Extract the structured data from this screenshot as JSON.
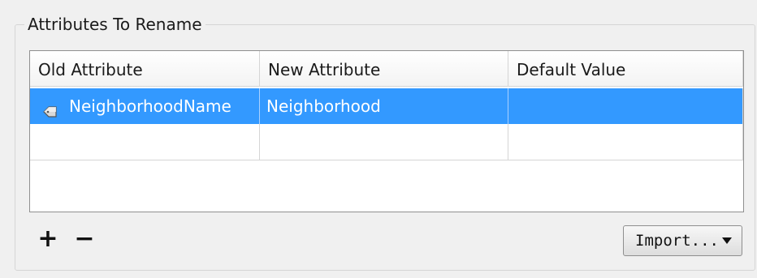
{
  "groupbox": {
    "title": "Attributes To Rename"
  },
  "table": {
    "columns": [
      "Old Attribute",
      "New Attribute",
      "Default Value"
    ],
    "rows": [
      {
        "old_attribute": "NeighborhoodName",
        "new_attribute": "Neighborhood",
        "default_value": "",
        "selected": true,
        "icon": "attribute-icon"
      },
      {
        "old_attribute": "",
        "new_attribute": "",
        "default_value": "",
        "selected": false
      }
    ]
  },
  "toolbar": {
    "add_label": "+",
    "remove_label": "−",
    "import_label": "Import..."
  },
  "colors": {
    "selection": "#3399ff",
    "background": "#f0f0f0"
  }
}
